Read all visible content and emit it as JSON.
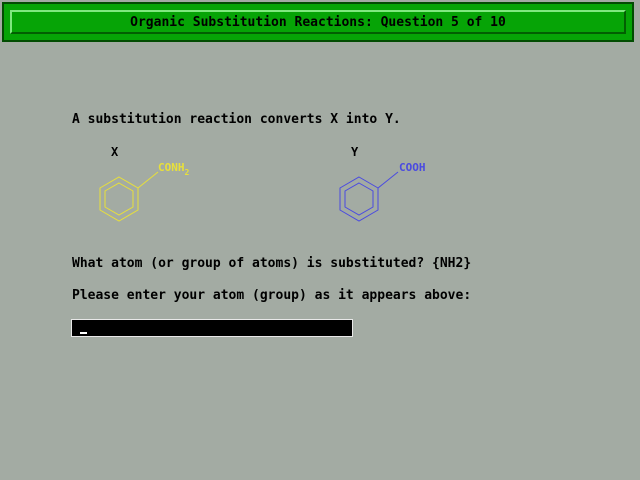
{
  "title": "Organic Substitution Reactions: Question 5 of 10",
  "prompt": "A substitution reaction converts X into Y.",
  "molecule_x": {
    "label": "X",
    "group": "CONH",
    "group_subscript": "2",
    "color": "#e8e03a"
  },
  "molecule_y": {
    "label": "Y",
    "group": "COOH",
    "color": "#4a4ae0"
  },
  "question": "What atom (or group of atoms) is substituted? {NH2}",
  "instruction": "Please enter your atom (group) as it appears above:",
  "answer": {
    "value": ""
  },
  "colors": {
    "background": "#a3aba3",
    "title_bar": "#06a406"
  }
}
